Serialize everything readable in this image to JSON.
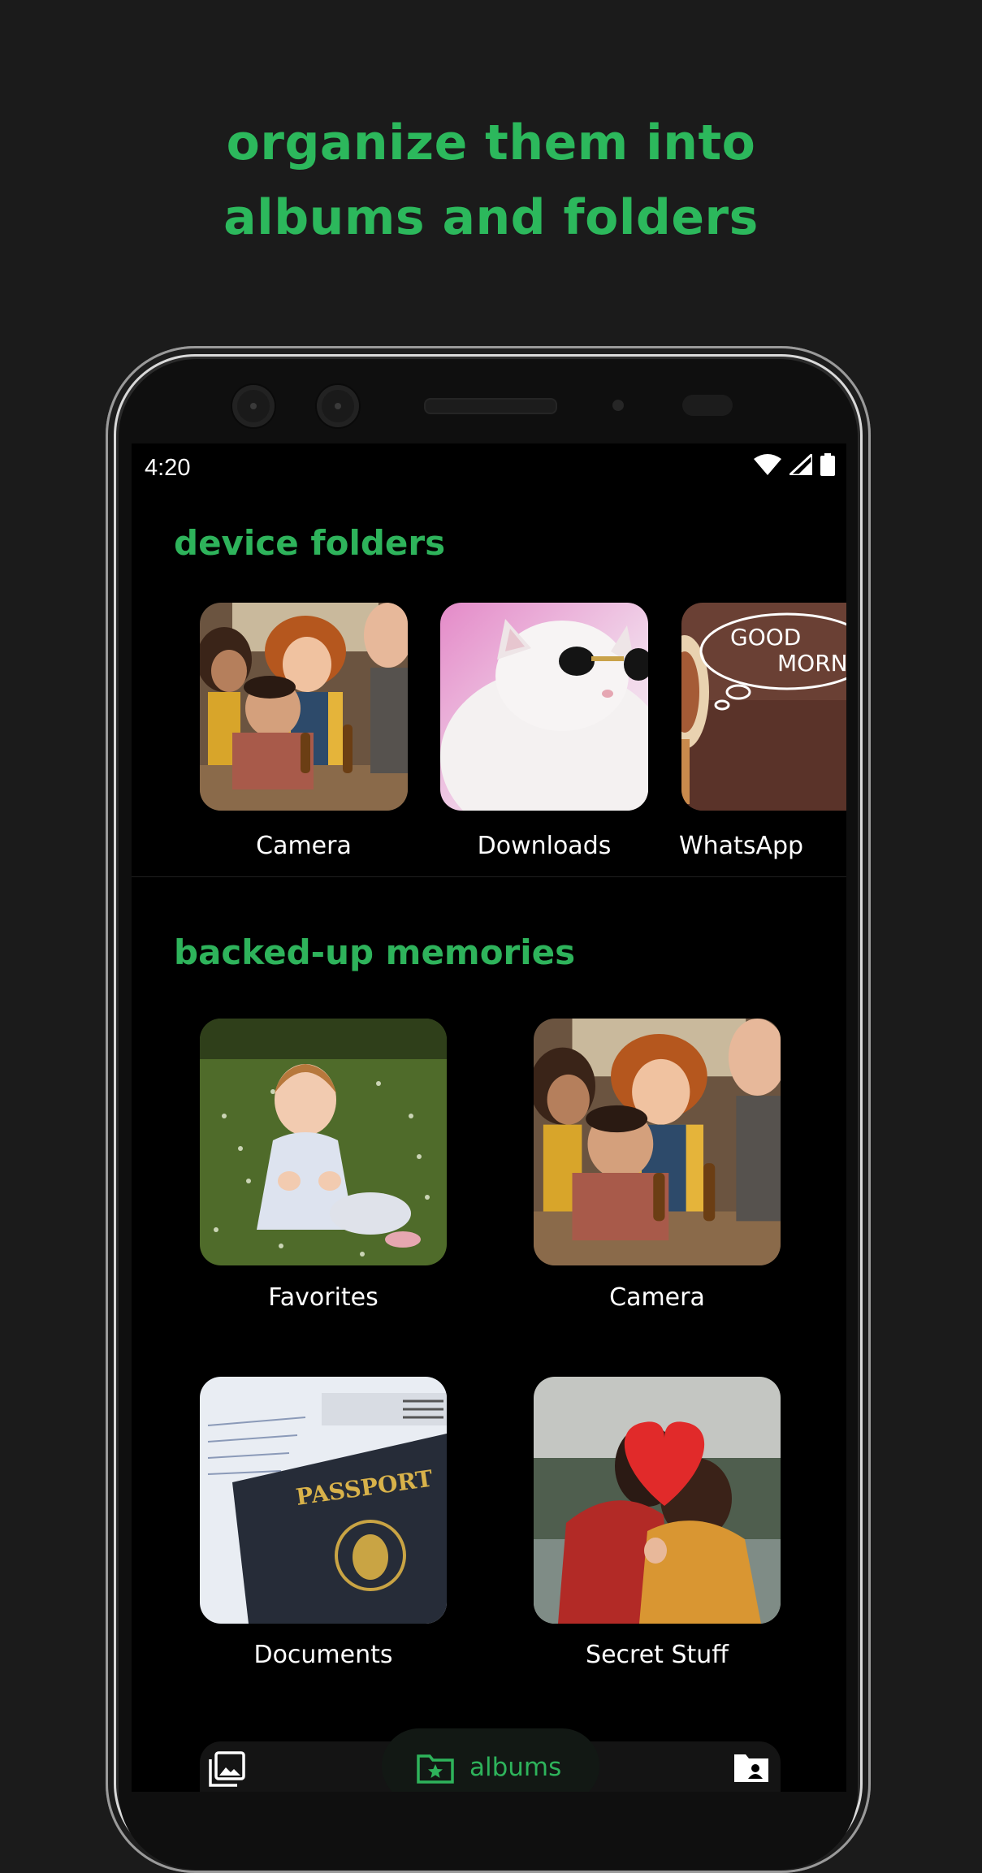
{
  "headline": {
    "line1": "organize them into",
    "line2": "albums and folders"
  },
  "status_bar": {
    "time": "4:20"
  },
  "device_folders": {
    "title": "device folders",
    "items": [
      {
        "label": "Camera",
        "icon": "group-photo"
      },
      {
        "label": "Downloads",
        "icon": "cat-sunglasses-photo"
      },
      {
        "label": "WhatsApp",
        "icon": "good-morning-photo",
        "thumb_text_1": "GOOD",
        "thumb_text_2": "MORNING"
      }
    ]
  },
  "backed_up": {
    "title": "backed-up memories",
    "items": [
      {
        "label": "Favorites",
        "icon": "baby-in-grass-photo"
      },
      {
        "label": "Camera",
        "icon": "group-photo"
      },
      {
        "label": "Documents",
        "icon": "passport-photo",
        "thumb_text": "PASSPORT"
      },
      {
        "label": "Secret Stuff",
        "icon": "heart-balloon-photo"
      }
    ]
  },
  "bottom_nav": {
    "active_label": "albums",
    "items": [
      "photos-icon",
      "albums-icon",
      "shared-folder-icon"
    ]
  },
  "colors": {
    "accent": "#2eb35b",
    "background": "#1b1b1b",
    "screen": "#000000"
  }
}
